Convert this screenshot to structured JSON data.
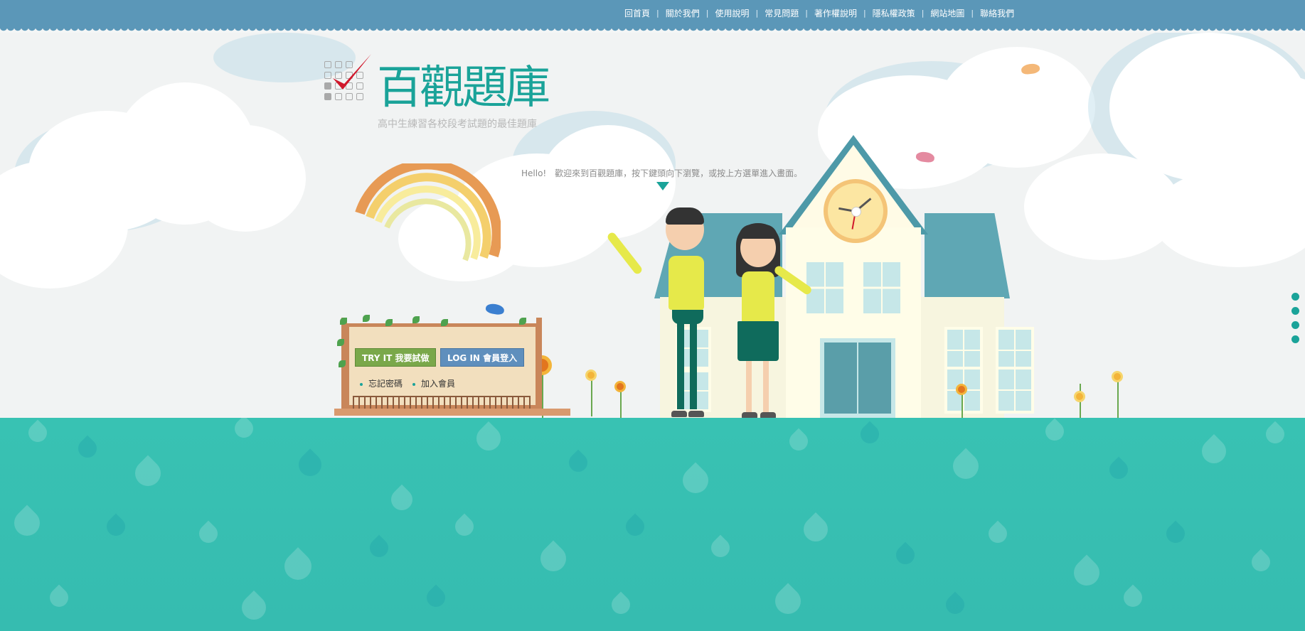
{
  "top_nav": {
    "items": [
      "回首頁",
      "關於我們",
      "使用說明",
      "常見問題",
      "著作權說明",
      "隱私權政策",
      "網站地圖",
      "聯絡我們"
    ],
    "separator": "|"
  },
  "brand": {
    "title": "百觀題庫",
    "subtitle": "高中生練習各校段考試題的最佳題庫"
  },
  "welcome": {
    "hello": "Hello!",
    "message": "歡迎來到百觀題庫，按下鍵頭向下瀏覽，或按上方選單進入畫面。"
  },
  "sign": {
    "try_button": "TRY IT 我要試做",
    "login_button": "LOG IN 會員登入",
    "forgot_link": "忘記密碼",
    "join_link": "加入會員"
  },
  "colors": {
    "nav_bar": "#5b97b8",
    "brand_teal": "#1aa399",
    "ground": "#38c2b3",
    "try_button": "#7aa84a",
    "login_button": "#5f8fbd"
  },
  "icons": {
    "scroll_down": "triangle-down-icon",
    "page_dots": "dot-icon"
  }
}
